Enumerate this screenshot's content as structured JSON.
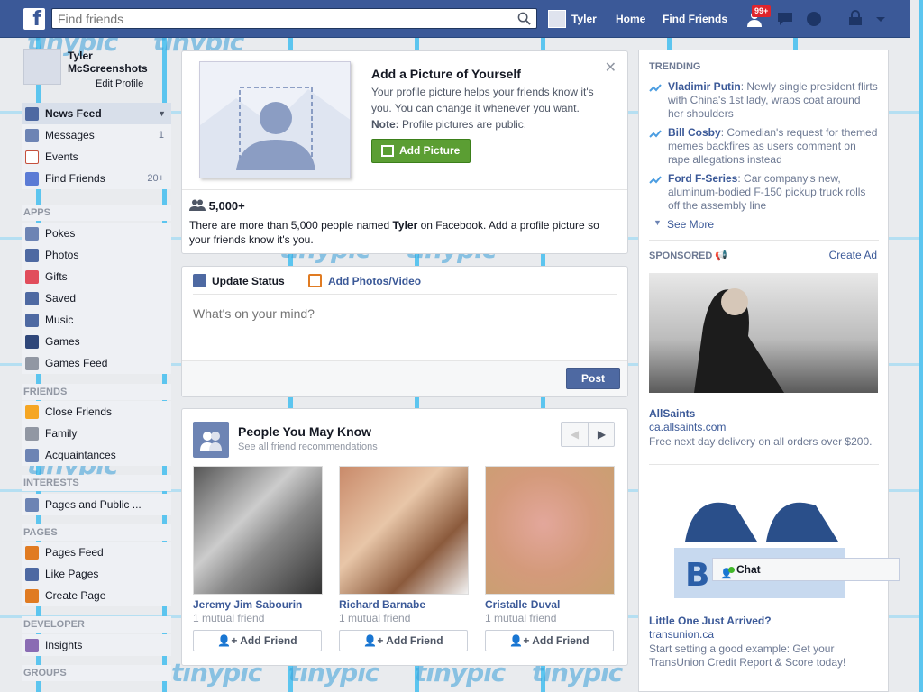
{
  "topbar": {
    "search_placeholder": "Find friends",
    "user_name": "Tyler",
    "home": "Home",
    "find_friends": "Find Friends",
    "requests_count": "99+"
  },
  "left": {
    "profile_name": "Tyler McScreenshots",
    "edit_profile": "Edit Profile",
    "favorites": [
      {
        "label": "News Feed",
        "count": ""
      },
      {
        "label": "Messages",
        "count": "1"
      },
      {
        "label": "Events",
        "count": ""
      },
      {
        "label": "Find Friends",
        "count": "20+"
      }
    ],
    "apps_header": "APPS",
    "apps": [
      "Pokes",
      "Photos",
      "Gifts",
      "Saved",
      "Music",
      "Games",
      "Games Feed"
    ],
    "friends_header": "FRIENDS",
    "friends": [
      "Close Friends",
      "Family",
      "Acquaintances"
    ],
    "interests_header": "INTERESTS",
    "interests": [
      "Pages and Public ..."
    ],
    "pages_header": "PAGES",
    "pages": [
      "Pages Feed",
      "Like Pages",
      "Create Page"
    ],
    "developer_header": "DEVELOPER",
    "developer": [
      "Insights"
    ],
    "groups_header": "GROUPS"
  },
  "picbox": {
    "title": "Add a Picture of Yourself",
    "desc": "Your profile picture helps your friends know it's you. You can change it whenever you want.",
    "note_label": "Note:",
    "note_text": " Profile pictures are public.",
    "button": "Add Picture",
    "count": "5,000+",
    "count_desc_a": "There are more than 5,000 people named ",
    "count_name": "Tyler",
    "count_desc_b": " on Facebook. Add a profile picture so your friends know it's you."
  },
  "composer": {
    "tab_status": "Update Status",
    "tab_photos": "Add Photos/Video",
    "placeholder": "What's on your mind?",
    "post": "Post"
  },
  "pymk": {
    "title": "People You May Know",
    "subtitle": "See all friend recommendations",
    "people": [
      {
        "name": "Jeremy Jim Sabourin",
        "mutual": "1 mutual friend",
        "button": "Add Friend"
      },
      {
        "name": "Richard Barnabe",
        "mutual": "1 mutual friend",
        "button": "Add Friend"
      },
      {
        "name": "Cristalle Duval",
        "mutual": "1 mutual friend",
        "button": "Add Friend"
      }
    ]
  },
  "right": {
    "trending_header": "TRENDING",
    "trends": [
      {
        "name": "Vladimir Putin",
        "text": ": Newly single president flirts with China's 1st lady, wraps coat around her shoulders"
      },
      {
        "name": "Bill Cosby",
        "text": ": Comedian's request for themed memes backfires as users comment on rape allegations instead"
      },
      {
        "name": "Ford F-Series",
        "text": ": Car company's new, aluminum-bodied F-150 pickup truck rolls off the assembly line"
      }
    ],
    "see_more": "See More",
    "sponsored_header": "SPONSORED",
    "create_ad": "Create Ad",
    "ads": [
      {
        "title": "AllSaints",
        "site": "ca.allsaints.com",
        "text": "Free next day delivery on all orders over $200."
      },
      {
        "title": "Little One Just Arrived?",
        "site": "transunion.ca",
        "text": "Start setting a good example: Get your TransUnion Credit Report & Score today!"
      }
    ]
  },
  "chat": {
    "label": "Chat"
  },
  "colors": {
    "brand": "#3b5998",
    "add_picture_green": "#5b9e33",
    "badge_red": "#e0242c"
  }
}
